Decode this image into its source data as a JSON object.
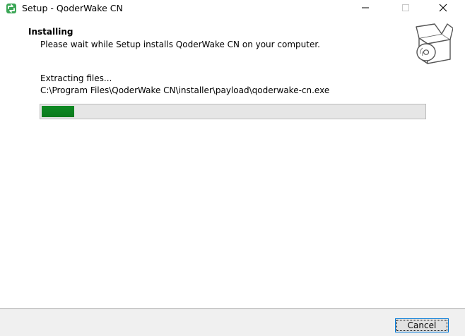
{
  "window": {
    "title": "Setup - QoderWake CN",
    "icon": "installer-app-icon",
    "controls": {
      "minimize": "minimize-icon",
      "maximize": "maximize-icon",
      "close": "close-icon"
    }
  },
  "header": {
    "title": "Installing",
    "subtitle": "Please wait while Setup installs QoderWake CN on your computer.",
    "icon": "setup-box-disc-icon"
  },
  "body": {
    "status": "Extracting files...",
    "current_file": "C:\\Program Files\\QoderWake CN\\installer\\payload\\qoderwake-cn.exe"
  },
  "progress": {
    "percent": 8.5,
    "fill_color": "#0f8a24",
    "track_color": "#e6e6e6"
  },
  "footer": {
    "cancel_label": "Cancel"
  }
}
